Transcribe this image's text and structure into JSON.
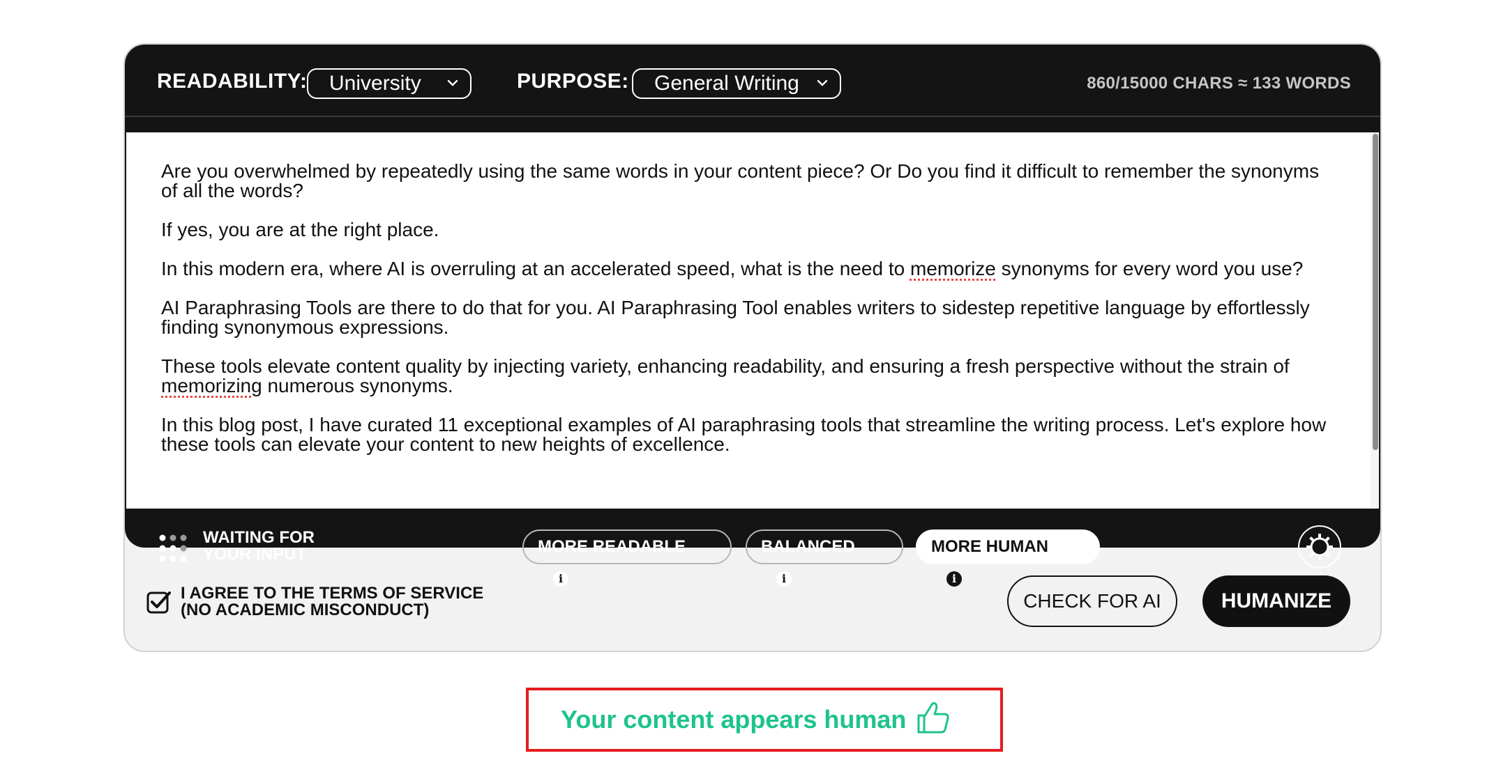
{
  "toolbar": {
    "readability_label": "READABILITY:",
    "readability_value": "University",
    "purpose_label": "PURPOSE:",
    "purpose_value": "General Writing",
    "counter": "860/15000 CHARS ≈ 133 WORDS"
  },
  "editor": {
    "paragraphs": {
      "p1": "Are you overwhelmed by repeatedly using the same words in your content piece? Or Do you find it difficult to remember the synonyms of all the words?",
      "p2": "If yes, you are at the right place.",
      "p3_a": "In this modern era, where AI is overruling at an accelerated speed, what is the need to ",
      "p3_misspelled": "memorize",
      "p3_b": " synonyms for every word you use?",
      "p4": "AI Paraphrasing Tools are there to do that for you. AI Paraphrasing Tool enables writers to sidestep repetitive language by effortlessly finding synonymous expressions.",
      "p5_a": "These tools elevate content quality by injecting variety, enhancing readability, and ensuring a fresh perspective without the strain of ",
      "p5_misspelled": "memorizing",
      "p5_b": " numerous synonyms.",
      "p6": "In this blog post, I have curated 11 exceptional examples of AI paraphrasing tools that streamline the writing process. Let's explore how these tools can elevate your content to new heights of excellence."
    }
  },
  "actionbar": {
    "status_line1": "WAITING FOR",
    "status_line2": "YOUR INPUT",
    "modes": {
      "more_readable": "MORE READABLE",
      "balanced": "BALANCED",
      "more_human": "MORE HUMAN"
    },
    "active_mode": "MORE HUMAN",
    "info_glyph": "i"
  },
  "footer": {
    "agree_line1": "I AGREE TO THE TERMS OF SERVICE",
    "agree_line2": "(NO ACADEMIC MISCONDUCT)",
    "agree_checked": true,
    "check_ai_label": "CHECK FOR AI",
    "humanize_label": "HUMANIZE"
  },
  "result": {
    "message": "Your content appears human"
  },
  "colors": {
    "dark": "#141414",
    "accent_green": "#1ec38b",
    "highlight_red": "#e41d1d"
  },
  "icons": {
    "status": "dots-grid-icon",
    "mode_info": "info-icon",
    "settings": "gear-icon",
    "agree": "checkbox-checked-icon",
    "result": "thumbs-up-icon",
    "dropdown": "chevron-down-icon"
  }
}
